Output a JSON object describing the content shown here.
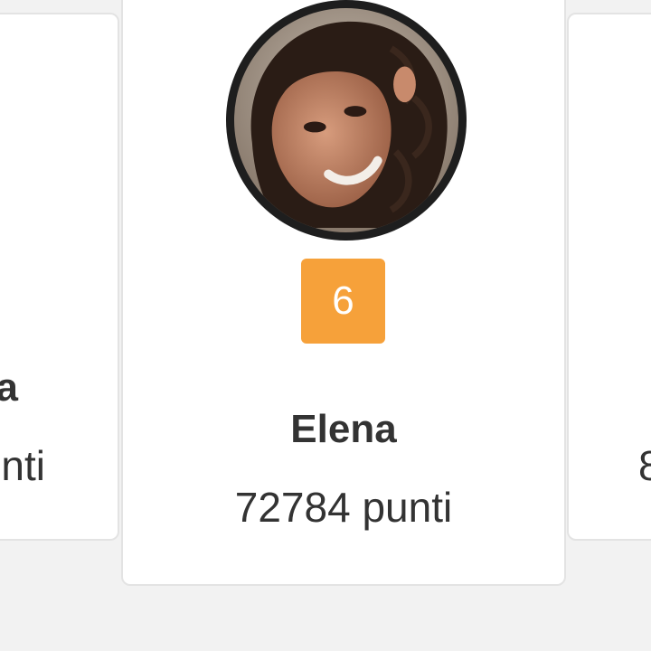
{
  "leaderboard": {
    "left_card": {
      "name_fragment": "a",
      "points_fragment": "nti"
    },
    "center_card": {
      "name": "Elena",
      "rank": "6",
      "points_label": "72784 punti"
    },
    "right_card": {
      "points_fragment": "8"
    }
  },
  "colors": {
    "rank_badge": "#f6a13a",
    "card_background": "#ffffff",
    "page_background": "#f2f2f2",
    "avatar_ring": "#1e1e1e",
    "text": "#333333"
  }
}
